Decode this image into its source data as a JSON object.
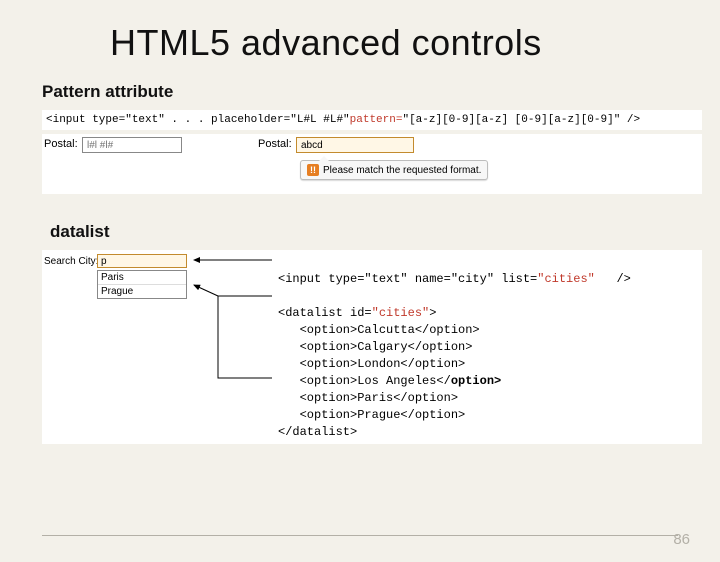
{
  "title": "HTML5 advanced controls",
  "section1": "Pattern attribute",
  "section2": "datalist",
  "code1": {
    "pre": "<input type=\"text\" . . . placeholder=\"L#L #L#\" ",
    "hl": "pattern=",
    "post": "\"[a-z][0-9][a-z] [0-9][a-z][0-9]\"   />"
  },
  "ex": {
    "label1": "Postal:",
    "placeholder1": "l#l #l#",
    "label2": "Postal:",
    "value2": "abcd",
    "tooltip": "Please match the requested format.",
    "tooltip_badge": "!!"
  },
  "dl": {
    "label": "Search City:",
    "input_value": "p",
    "suggestions": [
      "Paris",
      "Prague"
    ],
    "lines": [
      {
        "t": "<input type=\"text\" name=\"city\" list=",
        "hl": "\"cities\"",
        "post": "   />"
      },
      {
        "t": ""
      },
      {
        "t": "<datalist id=",
        "hl": "\"cities\"",
        "post": ">"
      },
      {
        "t": "   <option>Calcutta</option>"
      },
      {
        "t": "   <option>Calgary</option>"
      },
      {
        "t": "   <option>London</option>"
      },
      {
        "t": "   <option>Los Angeles</"
      },
      {
        "t": "   <option>Paris</option>"
      },
      {
        "t": "   <option>Prague</option>"
      },
      {
        "t": "</datalist>"
      }
    ],
    "line6_bold": "option>"
  },
  "page": "86"
}
